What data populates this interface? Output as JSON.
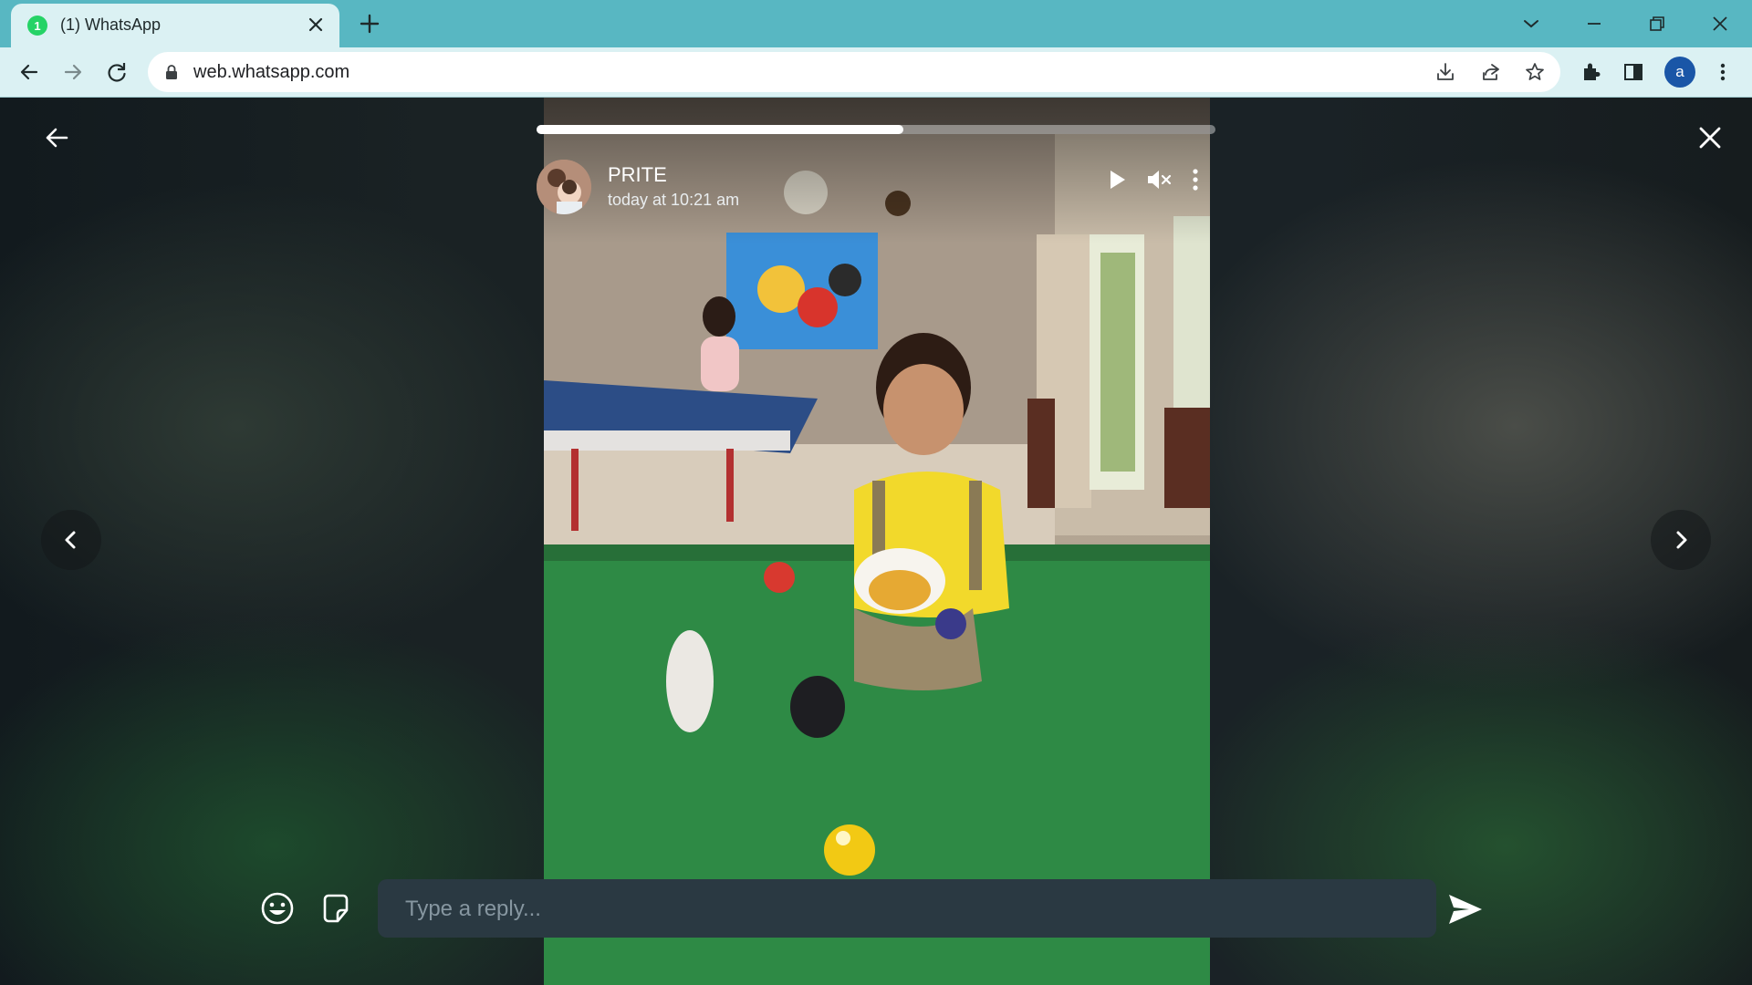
{
  "browser": {
    "tab_title": "(1) WhatsApp",
    "tab_badge": "1",
    "url": "web.whatsapp.com",
    "profile_initial": "a"
  },
  "status": {
    "contact_name": "PRITE",
    "timestamp": "today at 10:21 am",
    "progress": 0.54,
    "reply_placeholder": "Type a reply..."
  },
  "icons": {
    "back": "arrow-left-icon",
    "close": "close-icon",
    "play": "play-icon",
    "mute": "volume-muted-icon",
    "menu": "kebab-menu-icon",
    "prev": "chevron-left-icon",
    "next": "chevron-right-icon",
    "emoji": "emoji-icon",
    "sticker": "sticker-icon",
    "send": "send-icon"
  },
  "colors": {
    "chrome_accent": "#58b7c2",
    "whatsapp_green": "#25d366",
    "reply_bar": "#2a3942"
  }
}
